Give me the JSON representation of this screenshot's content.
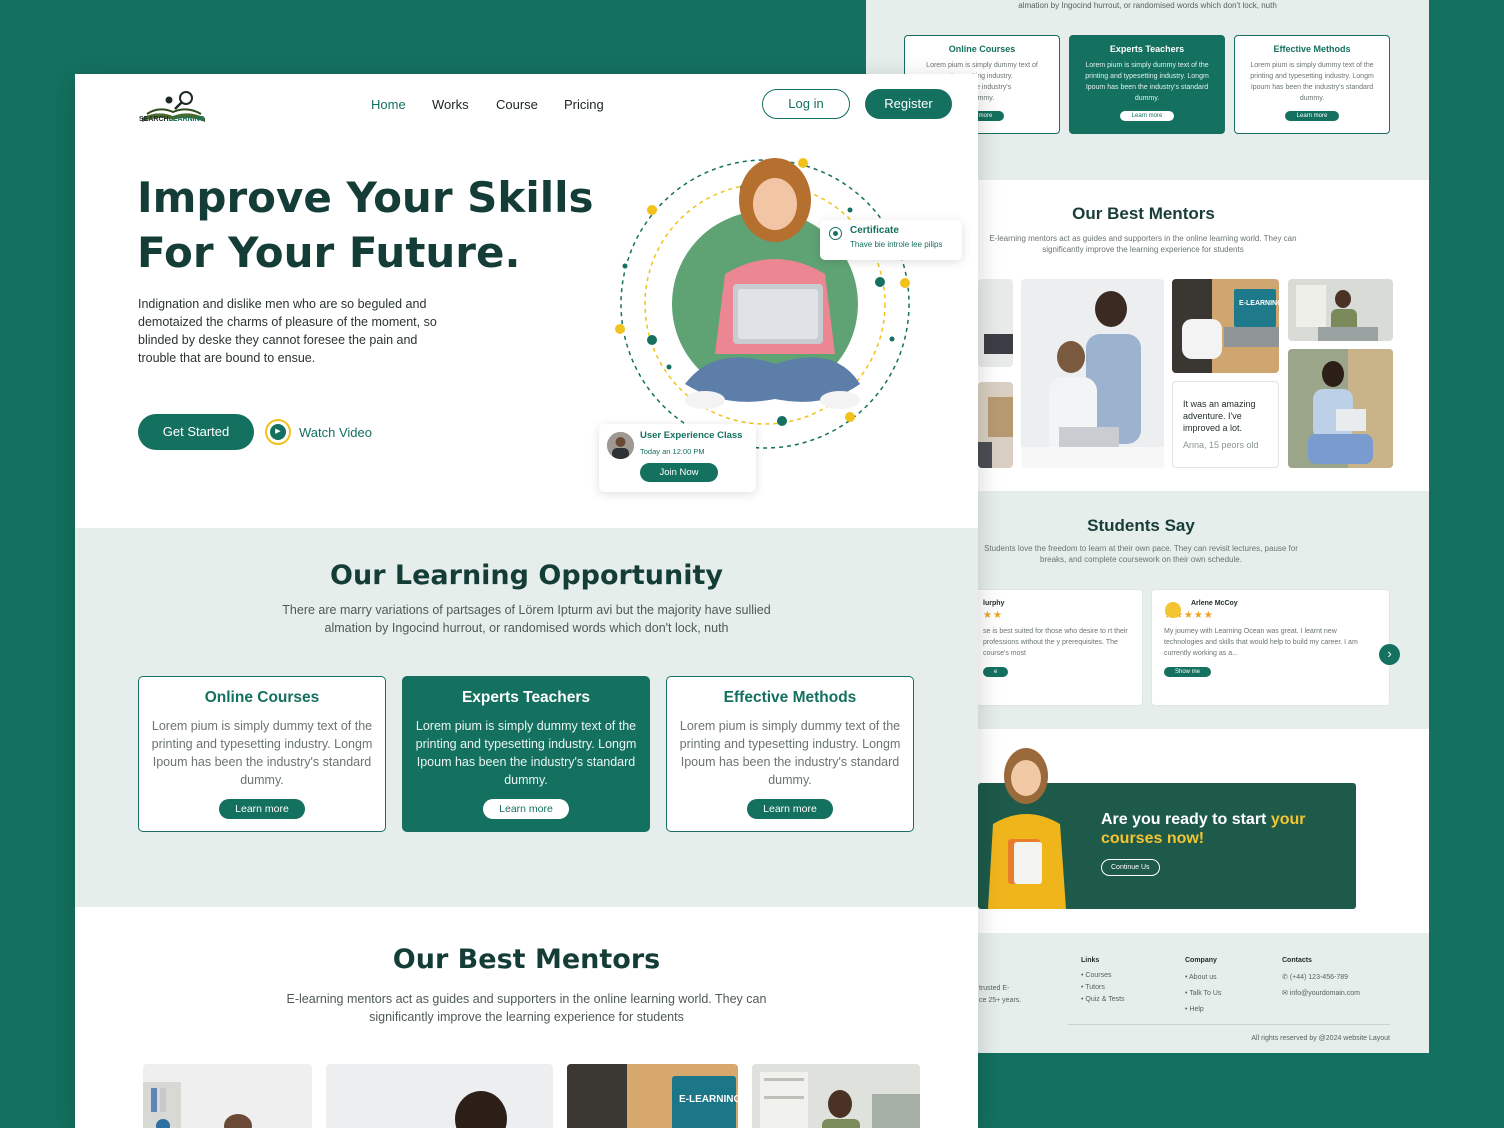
{
  "colors": {
    "brand": "#14705f",
    "accent": "#f2c21b",
    "dark_text": "#153d37",
    "section_bg": "#e6eeec"
  },
  "header": {
    "logo_text_1": "SEARCH",
    "logo_text_2": "LEARNING",
    "nav": [
      "Home",
      "Works",
      "Course",
      "Pricing"
    ],
    "active_nav": "Home",
    "login_label": "Log in",
    "register_label": "Register"
  },
  "hero": {
    "title_line1": "Improve Your Skills",
    "title_line2": "For Your Future.",
    "description": "Indignation and dislike men who are so beguled and demotaized the charms of pleasure of the moment, so blinded by deske they cannot foresee the pain and trouble that are bound to ensue.",
    "cta_label": "Get Started",
    "video_label": "Watch Video",
    "certificate": {
      "title": "Certificate",
      "subtitle": "Thave bie introle lee pilips"
    },
    "class_card": {
      "title": "User Experience Class",
      "time": "Today an 12:00 PM",
      "button": "Join Now"
    }
  },
  "learning": {
    "title": "Our Learning Opportunity",
    "description_line1": "There are marry variations of partsages of Lörem Ipturm avi but the majority have sullied",
    "description_line2": "almation by Ingocind hurrout, or randomised words which don't lock, nuth",
    "cards": [
      {
        "title": "Online Courses",
        "text": "Lorem pium is simply dummy text of the printing and typesetting industry. Longm Ipoum has been the industry's standard dummy.",
        "button": "Learn more"
      },
      {
        "title": "Experts Teachers",
        "text": "Lorem pium is simply dummy text of the printing and typesetting industry. Longm Ipoum has been the industry's standard dummy.",
        "button": "Learn more"
      },
      {
        "title": "Effective Methods",
        "text": "Lorem pium is simply dummy text of the printing and typesetting industry. Longm Ipoum has been the industry's standard dummy.",
        "button": "Learn more"
      }
    ],
    "active_card": 1
  },
  "mentors": {
    "title": "Our Best Mentors",
    "description": "E-learning mentors act as guides and supporters in the online learning world. They can significantly improve the learning experience for students",
    "quote": "It was an amazing adventure. I've improved a lot.",
    "quote_author": "Anna, 15 peors old",
    "photo_label": "E-LEARNING"
  },
  "back": {
    "card_text_partial_1": "Lorem pium is simply dummy text of",
    "card_text_partial_2": "typesetting industry.",
    "card_text_partial_3": "been the industry's",
    "card_text_partial_4": "dummy.",
    "card_button_partial": "rn more"
  },
  "students": {
    "title": "Students Say",
    "description": "Students love the freedom to learn at their own pace. They can revisit lectures, pause for breaks, and complete coursework on their own schedule.",
    "reviews": [
      {
        "name": "lurphy",
        "stars": "★★",
        "text": "se is best suited for those who desire to rt their professions without the y prerequisites. The course's most",
        "button": "e"
      },
      {
        "name": "Arlene McCoy",
        "stars": "★★★★★",
        "text": "My journey with Learning Ocean was great. I learnt new technologies and skills that would help to build my career. I am currently working as a...",
        "button": "Show me"
      }
    ]
  },
  "cta": {
    "line1": "Are you ready to start ",
    "highlight1": "your",
    "highlight2": "courses now!",
    "button": "Continue Us"
  },
  "footer": {
    "about_partial_1": "trusted E-",
    "about_partial_2": "ce 25+ years.",
    "links_title": "Links",
    "links": [
      "• Courses",
      "• Tutors",
      "• Quiz & Tests"
    ],
    "company_title": "Company",
    "company": [
      "• About us",
      "• Talk To Us",
      "• Help"
    ],
    "contacts_title": "Contacts",
    "phone": "(+44) 123-456-789",
    "email": "info@yourdomain.com",
    "copyright": "All rights reserved by @2024  website Layout"
  }
}
